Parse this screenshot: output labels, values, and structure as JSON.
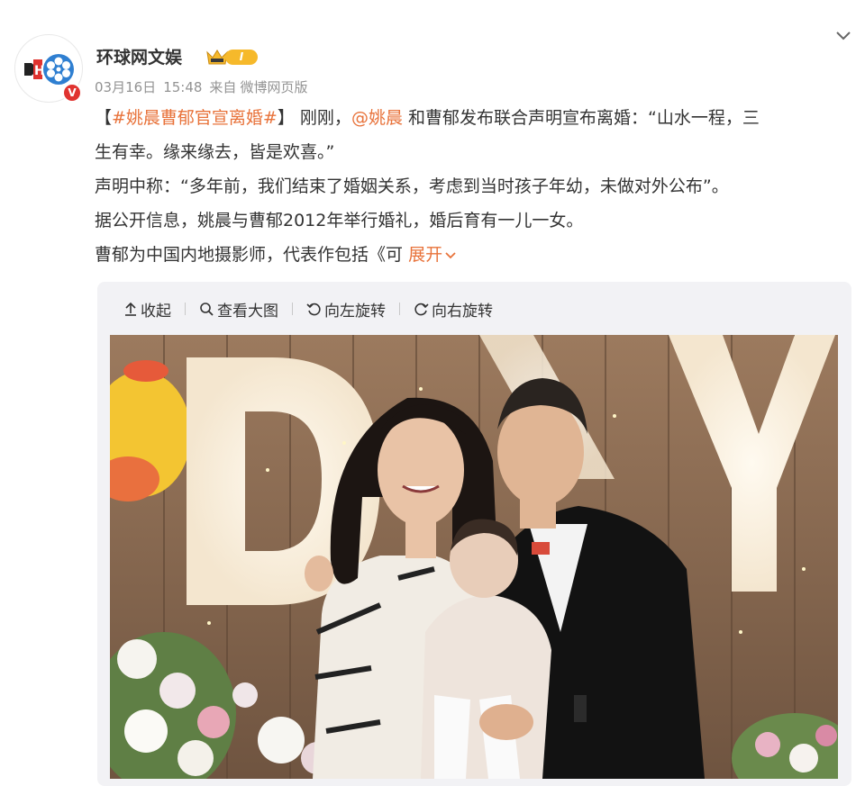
{
  "account": {
    "name": "环球网文娱",
    "level": "I",
    "verified_mark": "V",
    "avatar_icon": "film-reel-logo-icon"
  },
  "meta": {
    "date": "03月16日",
    "time": "15:48",
    "source_prefix": "来自",
    "source": "微博网页版"
  },
  "post": {
    "hashtag_open": "【",
    "hashtag": "#姚晨曹郁官宣离婚#",
    "hashtag_close": "】",
    "segment1": "刚刚，",
    "mention": "@姚晨",
    "segment2": " 和曹郁发布联合声明宣布离婚：“山水一程，三",
    "line2": "生有幸。缘来缘去，皆是欢喜。”",
    "line3": "声明中称：“多年前，我们结束了婚姻关系，考虑到当时孩子年幼，未做对外公布”。",
    "line4": "据公开信息，姚晨与曹郁2012年举行婚礼，婚后育有一儿一女。",
    "line5": "曹郁为中国内地摄影师，代表作包括《可",
    "expand_label": "展开"
  },
  "toolbar": {
    "collapse": "收起",
    "view_large": "查看大图",
    "rotate_left": "向左旋转",
    "rotate_right": "向右旋转"
  },
  "colors": {
    "link": "#e8723a",
    "meta_text": "#939393",
    "card_bg": "#f2f2f5",
    "badge_gold": "#f6b92b",
    "verified_red": "#e0332f"
  }
}
